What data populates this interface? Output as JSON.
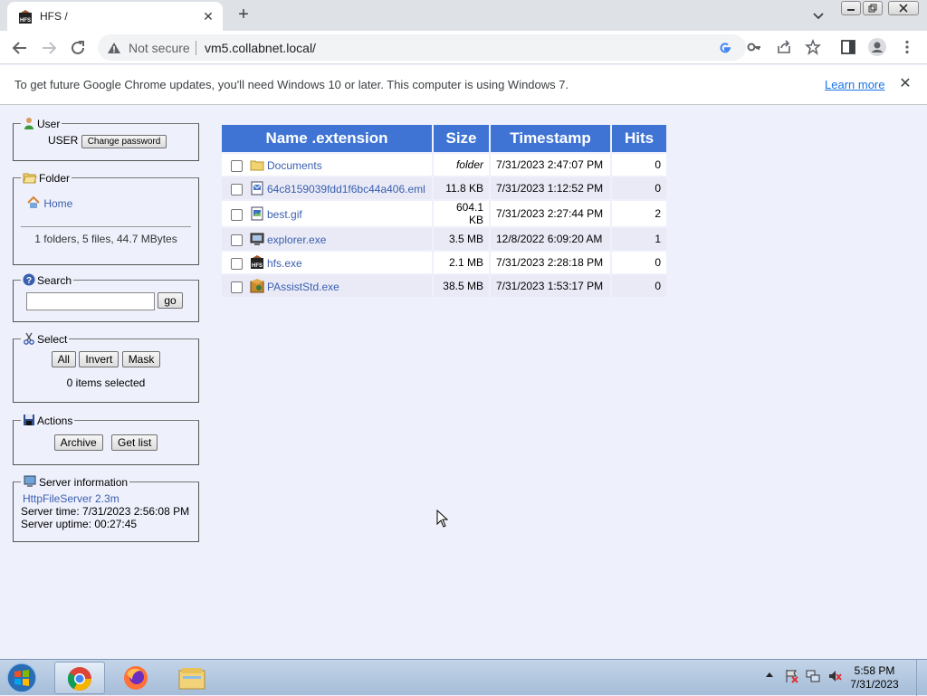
{
  "browser": {
    "tab_title": "HFS /",
    "new_tab_label": "+",
    "not_secure_label": "Not secure",
    "url": "vm5.collabnet.local/"
  },
  "infobar": {
    "message": "To get future Google Chrome updates, you'll need Windows 10 or later. This computer is using Windows 7.",
    "learn_more": "Learn more"
  },
  "sidebar": {
    "user": {
      "legend": "User",
      "name": "USER",
      "change_password": "Change password"
    },
    "folder": {
      "legend": "Folder",
      "home_link": "Home",
      "summary": "1 folders, 5 files, 44.7 MBytes"
    },
    "search": {
      "legend": "Search",
      "value": "",
      "go_label": "go"
    },
    "select": {
      "legend": "Select",
      "all_label": "All",
      "invert_label": "Invert",
      "mask_label": "Mask",
      "selected_info": "0 items selected"
    },
    "actions": {
      "legend": "Actions",
      "archive_label": "Archive",
      "getlist_label": "Get list"
    },
    "server": {
      "legend": "Server information",
      "software_link": "HttpFileServer 2.3m",
      "server_time": "Server time: 7/31/2023 2:56:08 PM",
      "server_uptime": "Server uptime: 00:27:45"
    }
  },
  "files": {
    "headers": [
      "Name .extension",
      "Size",
      "Timestamp",
      "Hits"
    ],
    "rows": [
      {
        "name": "Documents",
        "size": "folder",
        "timestamp": "7/31/2023 2:47:07 PM",
        "hits": "0",
        "icon": "folder-icon"
      },
      {
        "name": "64c8159039fdd1f6bc44a406.eml",
        "size": "11.8 KB",
        "timestamp": "7/31/2023 1:12:52 PM",
        "hits": "0",
        "icon": "email-file-icon"
      },
      {
        "name": "best.gif",
        "size": "604.1 KB",
        "timestamp": "7/31/2023 2:27:44 PM",
        "hits": "2",
        "icon": "image-file-icon"
      },
      {
        "name": "explorer.exe",
        "size": "3.5 MB",
        "timestamp": "12/8/2022 6:09:20 AM",
        "hits": "1",
        "icon": "exe-file-icon"
      },
      {
        "name": "hfs.exe",
        "size": "2.1 MB",
        "timestamp": "7/31/2023 2:28:18 PM",
        "hits": "0",
        "icon": "hfs-exe-icon"
      },
      {
        "name": "PAssistStd.exe",
        "size": "38.5 MB",
        "timestamp": "7/31/2023 1:53:17 PM",
        "hits": "0",
        "icon": "package-exe-icon"
      }
    ]
  },
  "taskbar": {
    "time": "5:58 PM",
    "date": "7/31/2023"
  },
  "colors": {
    "table_header": "#3f74d4",
    "page_background": "#eef0fb",
    "link": "#3a5fb0"
  }
}
